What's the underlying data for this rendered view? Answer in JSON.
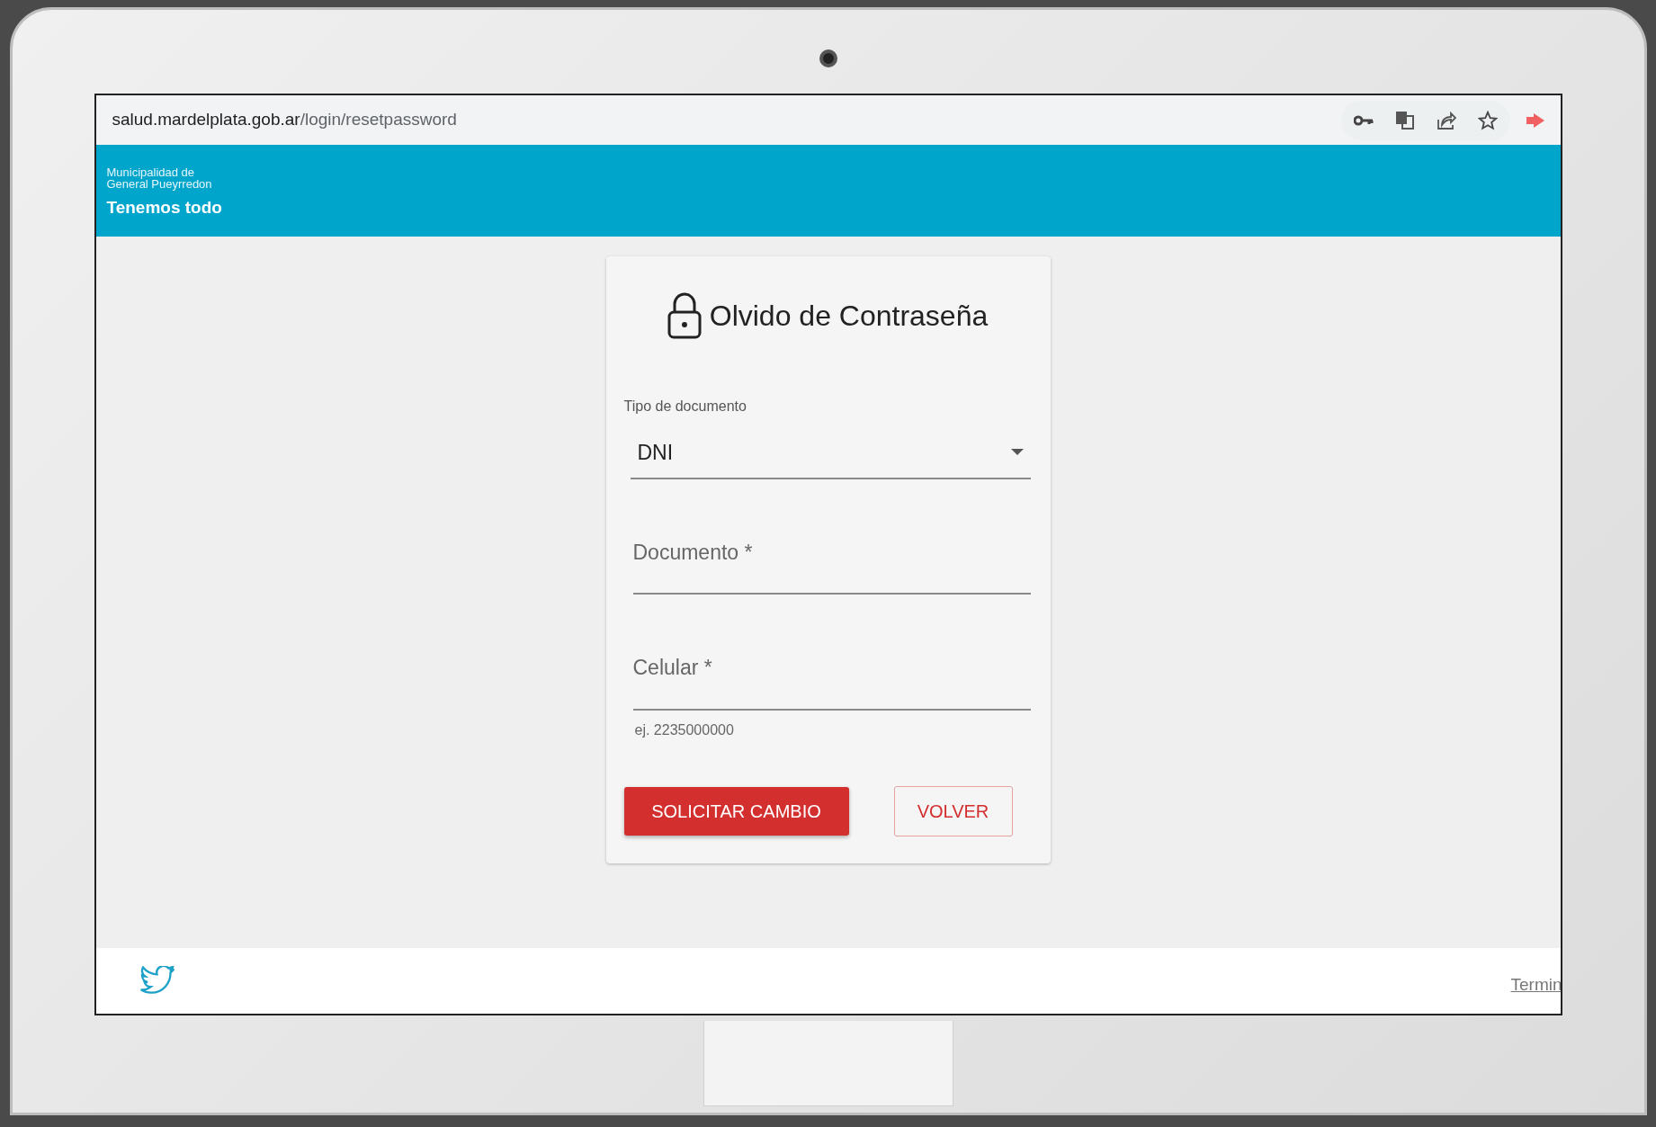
{
  "browser": {
    "url_host": "salud.mardelplata.gob.ar",
    "url_path": "/login/resetpassword"
  },
  "header": {
    "org_line_1": "Municipalidad de",
    "org_line_2": "General Pueyrredon",
    "slogan": "Tenemos todo"
  },
  "form": {
    "title": "Olvido de Contraseña",
    "fields": [
      {
        "kind": "select",
        "label": "Tipo de documento",
        "value": "DNI"
      },
      {
        "kind": "text",
        "placeholder": "Documento *"
      },
      {
        "kind": "text",
        "placeholder": "Celular *",
        "hint": "ej. 2235000000"
      }
    ],
    "buttons": [
      {
        "kind": "primary",
        "label": "SOLICITAR CAMBIO"
      },
      {
        "kind": "outline",
        "label": "VOLVER"
      }
    ]
  },
  "footer": {
    "link": "Termin"
  }
}
